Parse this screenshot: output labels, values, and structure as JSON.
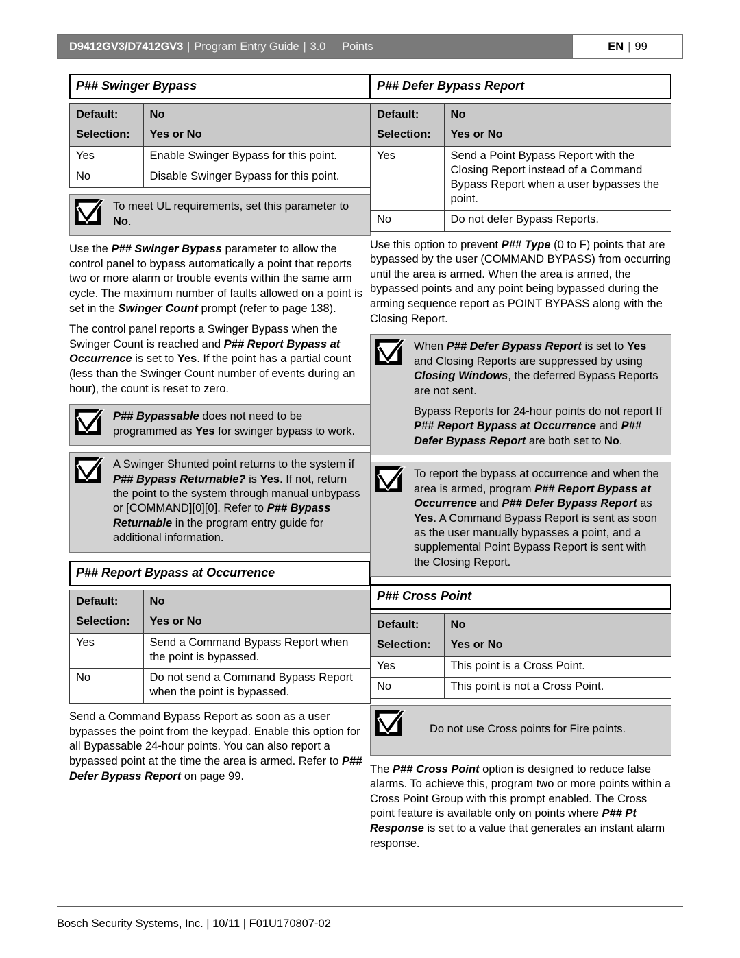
{
  "header": {
    "model": "D9412GV3/D7412GV3",
    "separator": "|",
    "guide": "Program Entry Guide",
    "version": "3.0",
    "chapter": "Points",
    "lang": "EN",
    "lang_separator": "|",
    "page_number": "99"
  },
  "icons": {
    "note": "checkmark-box-icon"
  },
  "left_column": {
    "section1": {
      "title": "P## Swinger Bypass",
      "table": {
        "default_label": "Default:",
        "default_value": "No",
        "selection_label": "Selection:",
        "selection_value": "Yes or No",
        "rows": [
          {
            "option": "Yes",
            "description": "Enable Swinger Bypass for this point."
          },
          {
            "option": "No",
            "description": "Disable Swinger Bypass for this point."
          }
        ]
      },
      "note1_pre": "To meet UL requirements, set this parameter to ",
      "note1_bold": "No",
      "note1_post": ".",
      "paragraph1": {
        "seg1": "Use the ",
        "seg2_bi": "P## Swinger Bypass",
        "seg3": " parameter to allow the control panel to bypass automatically a point that reports two or more alarm or trouble events within the same arm cycle. The maximum number of faults allowed on a point is set in the ",
        "seg4_bi": "Swinger Count",
        "seg5": " prompt (refer to page 138)."
      },
      "paragraph2": {
        "seg1": "The control panel reports a Swinger Bypass when the Swinger Count is reached and ",
        "seg2_bi": "P## Report Bypass at Occurrence",
        "seg3": " is set to ",
        "seg4_b": "Yes",
        "seg5": ". If the point has a partial count (less than the Swinger Count number of events during an hour), the count is reset to zero."
      },
      "note2": {
        "seg1_bi": "P## Bypassable",
        "seg2": " does not need to be programmed as ",
        "seg3_b": "Yes",
        "seg4": " for swinger bypass to work."
      },
      "note3": {
        "seg1": "A Swinger Shunted point returns to the system if ",
        "seg2_bi": "P## Bypass Returnable?",
        "seg3": " is ",
        "seg4_b": "Yes",
        "seg5": ". If not, return the point to the system through manual unbypass or [COMMAND][0][0]. Refer to ",
        "seg6_bi": "P## Bypass Returnable",
        "seg7": " in the program entry guide for additional information."
      }
    },
    "section2": {
      "title": "P## Report Bypass at Occurrence",
      "table": {
        "default_label": "Default:",
        "default_value": "No",
        "selection_label": "Selection:",
        "selection_value": "Yes or No",
        "rows": [
          {
            "option": "Yes",
            "description": "Send a Command Bypass Report when the point is bypassed."
          },
          {
            "option": "No",
            "description": "Do not send a Command Bypass Report when the point is bypassed."
          }
        ]
      },
      "paragraph1": {
        "seg1": "Send a Command Bypass Report as soon as a user bypasses the point from the keypad. Enable this option for all Bypassable 24-hour points. You can also report a bypassed point at the time the area is armed. Refer to ",
        "seg2_bi": "P## Defer Bypass Report",
        "seg3": " on page 99."
      }
    }
  },
  "right_column": {
    "section1": {
      "title": "P## Defer Bypass Report",
      "table": {
        "default_label": "Default:",
        "default_value": "No",
        "selection_label": "Selection:",
        "selection_value": "Yes or No",
        "rows": [
          {
            "option": "Yes",
            "description": "Send a Point Bypass Report with the Closing Report instead of a Command Bypass Report when a user bypasses the point."
          },
          {
            "option": "No",
            "description": "Do not defer Bypass Reports."
          }
        ]
      },
      "paragraph1": {
        "seg1": "Use this option to prevent ",
        "seg2_bi": "P## Type",
        "seg3": " (0 to F) points that are bypassed by the user (COMMAND BYPASS) from occurring until the area is armed. When the area is armed, the bypassed points and any point being bypassed during the arming sequence report as POINT BYPASS along with the Closing Report."
      },
      "note1_p1": {
        "seg1": "When ",
        "seg2_bi": "P## Defer Bypass Report",
        "seg3": " is set to ",
        "seg4_b": "Yes",
        "seg5": " and Closing Reports are suppressed by using ",
        "seg6_bi": "Closing Windows",
        "seg7": ", the deferred Bypass Reports are not sent."
      },
      "note1_p2": {
        "seg1": "Bypass Reports for 24-hour points do not report If ",
        "seg2_bi": "P## Report Bypass at Occurrence",
        "seg3": " and ",
        "seg4_bi": " P## Defer Bypass Report",
        "seg5": " are both set to ",
        "seg6_b": "No",
        "seg7": "."
      },
      "note2": {
        "seg1": "To report the bypass at occurrence and when the area is armed, program ",
        "seg2_bi": "P## Report Bypass at Occurrence",
        "seg3": " and ",
        "seg4_bi": "P## Defer Bypass Report",
        "seg5": " as ",
        "seg6_b": "Yes",
        "seg7": ". A Command Bypass Report is sent as soon as the user manually bypasses a point, and a supplemental Point Bypass Report is sent with the Closing Report."
      }
    },
    "section2": {
      "title": "P## Cross Point",
      "table": {
        "default_label": "Default:",
        "default_value": "No",
        "selection_label": "Selection:",
        "selection_value": "Yes or No",
        "rows": [
          {
            "option": "Yes",
            "description": "This point is a Cross Point."
          },
          {
            "option": "No",
            "description": "This point is not a Cross Point."
          }
        ]
      },
      "note1": "Do not use Cross points for Fire points.",
      "paragraph1": {
        "seg1": "The ",
        "seg2_bi": "P## Cross Point",
        "seg3": " option is designed to reduce false alarms. To achieve this, program two or more points within a Cross Point Group with this prompt enabled. The Cross point feature is available only on points where ",
        "seg4_bi": "P## Pt Response",
        "seg5": " is set to a value that generates an instant alarm response."
      }
    }
  },
  "footer": {
    "text": "Bosch Security Systems, Inc. | 10/11 | F01U170807-02"
  }
}
